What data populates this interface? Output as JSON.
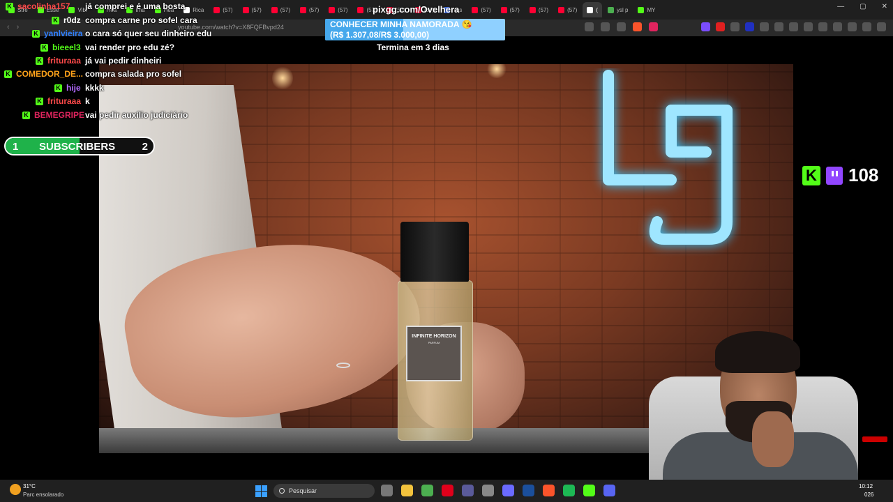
{
  "browser": {
    "tabs": [
      {
        "label": "Stre",
        "color": "#53fc18"
      },
      {
        "label": "Esse",
        "color": "#53fc18"
      },
      {
        "label": "Vibr",
        "color": "#53fc18"
      },
      {
        "label": "Hea",
        "color": "#53fc18"
      },
      {
        "label": "Ima",
        "color": "#53fc18"
      },
      {
        "label": "Hea",
        "color": "#53fc18"
      },
      {
        "label": "Rica",
        "color": "#ffffff"
      },
      {
        "label": "(57)",
        "color": "#ff0033"
      },
      {
        "label": "(57)",
        "color": "#ff0033"
      },
      {
        "label": "(57)",
        "color": "#ff0033"
      },
      {
        "label": "(57)",
        "color": "#ff0033"
      },
      {
        "label": "(57)",
        "color": "#ff0033"
      },
      {
        "label": "(57)",
        "color": "#ff0033"
      },
      {
        "label": "(57)",
        "color": "#ff0033"
      },
      {
        "label": "(57)",
        "color": "#ff0033"
      },
      {
        "label": "Yas",
        "color": "#4a7cff"
      },
      {
        "label": "(57)",
        "color": "#ff0033"
      },
      {
        "label": "(57)",
        "color": "#ff0033"
      },
      {
        "label": "(57)",
        "color": "#ff0033"
      },
      {
        "label": "(57)",
        "color": "#ff0033"
      },
      {
        "label": "(",
        "color": "#ffffff"
      },
      {
        "label": "ysl p",
        "color": "#4caf50"
      },
      {
        "label": "MY",
        "color": "#53fc18"
      }
    ],
    "url": "youtube.com/watch?v=X8FQFBvpd24"
  },
  "chat": {
    "messages": [
      {
        "user": "sacolinha157",
        "color": "#ff4a4a",
        "text": "já comprei e é uma bosta"
      },
      {
        "user": "r0dz",
        "color": "#ffffff",
        "text": "compra carne pro sofel cara"
      },
      {
        "user": "yanlvieira",
        "color": "#2f7fff",
        "text": "o cara só quer seu dinheiro edu"
      },
      {
        "user": "bieeel3",
        "color": "#53fc18",
        "text": "vai render pro edu zé?"
      },
      {
        "user": "frituraaa",
        "color": "#ff4a4a",
        "text": "já vai pedir dinheiri"
      },
      {
        "user": "COMEDOR_DE...",
        "color": "#ffa31a",
        "text": "compra salada pro sofel"
      },
      {
        "user": "hije",
        "color": "#b36bff",
        "text": "kkkk"
      },
      {
        "user": "frituraaa",
        "color": "#ff4a4a",
        "text": "k"
      },
      {
        "user": "BEMEGRIPE",
        "color": "#e0245e",
        "text": "vai pedir auxílio judiciário"
      }
    ]
  },
  "donation": {
    "pix_url": "pixgg.com/Ovelhera",
    "goal_title": "CONHECER MINHA NAMORADA 😘",
    "goal_amount": "(R$ 1.307,08/R$ 3.000,00)",
    "goal_progress": 0.436,
    "ends_text": "Termina em 3 dias"
  },
  "subscribers": {
    "current": "1",
    "label": "SUBSCRIBERS",
    "target": "2",
    "progress": 0.5
  },
  "viewers": {
    "count": "108"
  },
  "video": {
    "product_name": "INFINITE HORIZON",
    "product_sub": "PARFUM"
  },
  "taskbar": {
    "temperature": "31°C",
    "weather": "Parc ensolarado",
    "search_placeholder": "Pesquisar",
    "time": "10:12",
    "date": "026",
    "apps": [
      {
        "name": "task-view-icon",
        "color": "#777777"
      },
      {
        "name": "explorer-icon",
        "color": "#f3c33d"
      },
      {
        "name": "chrome-icon",
        "color": "#4caf50"
      },
      {
        "name": "opera-icon",
        "color": "#e0001b"
      },
      {
        "name": "app-icon",
        "color": "#5a5a9a"
      },
      {
        "name": "github-icon",
        "color": "#888888"
      },
      {
        "name": "app2-icon",
        "color": "#6a6aff"
      },
      {
        "name": "steam-icon",
        "color": "#1b4f9c"
      },
      {
        "name": "brave-icon",
        "color": "#fb542b"
      },
      {
        "name": "spotify-icon",
        "color": "#1db954"
      },
      {
        "name": "kick-icon",
        "color": "#53fc18"
      },
      {
        "name": "discord-icon",
        "color": "#5865f2"
      }
    ]
  }
}
